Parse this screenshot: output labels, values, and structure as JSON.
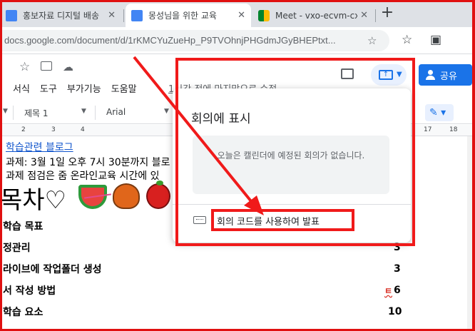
{
  "browser": {
    "tabs": [
      {
        "label": "홍보자료 디지털 배송",
        "active": false
      },
      {
        "label": "몽성님을 위한 교육",
        "active": true
      },
      {
        "label": "Meet - vxo-ecvm-cxt",
        "active": false
      }
    ],
    "url": "docs.google.com/document/d/1rKMCYuZueHp_P9TVOhnjPHGdmJGyBHEPtxt..."
  },
  "docs": {
    "menu": [
      "서식",
      "도구",
      "부가기능",
      "도움말"
    ],
    "last_edit": "1시간 전에 마지막으로 수정",
    "share_label": "공유",
    "toolbar": {
      "style": "제목 1",
      "font": "Arial"
    },
    "ruler_numbers": [
      "2",
      "3",
      "4",
      "17",
      "18"
    ]
  },
  "document": {
    "link_text": "학습관련 블로그",
    "line1": "과제: 3월 1일 오후 7시 30분까지 블로",
    "line2": "과제 점검은 줌 온라인교육 시간에 있",
    "toc_title": "목차♡",
    "toc": [
      {
        "title": "학습 목표",
        "page": ""
      },
      {
        "title": "정관리",
        "page": "3"
      },
      {
        "title": "라이브에 작업폴더 생성",
        "page": "3"
      },
      {
        "title": "서 작성 방법",
        "page": "6"
      },
      {
        "title": "학습 요소",
        "page": "10"
      }
    ],
    "spell_mark": "ㅌ"
  },
  "meeting_popup": {
    "title": "회의에 표시",
    "empty_message": "오늘은 캘린더에 예정된 회의가 없습니다.",
    "code_label": "회의 코드를 사용하여 발표"
  },
  "colors": {
    "annotation": "#f01a1a",
    "share_button": "#1a73e8",
    "link": "#1155cc"
  }
}
